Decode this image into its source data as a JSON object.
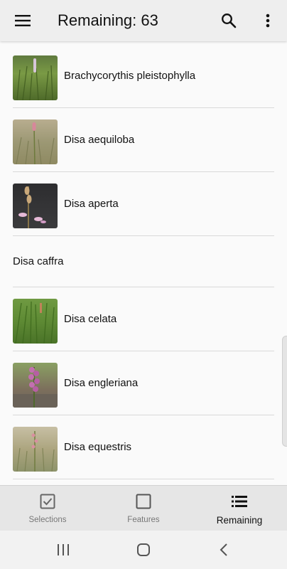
{
  "app_bar": {
    "title": "Remaining: 63",
    "menu_icon": "hamburger-menu-icon",
    "search_icon": "search-icon",
    "more_icon": "more-vert-icon"
  },
  "list": {
    "items": [
      {
        "label": "Brachycorythis pleistophylla",
        "has_image": true
      },
      {
        "label": "Disa aequiloba",
        "has_image": true
      },
      {
        "label": "Disa aperta",
        "has_image": true
      },
      {
        "label": "Disa caffra",
        "has_image": false
      },
      {
        "label": "Disa celata",
        "has_image": true
      },
      {
        "label": "Disa engleriana",
        "has_image": true
      },
      {
        "label": "Disa equestris",
        "has_image": true
      }
    ]
  },
  "bottom_nav": {
    "items": [
      {
        "label": "Selections",
        "icon": "checkbox-checked-icon",
        "active": false
      },
      {
        "label": "Features",
        "icon": "checkbox-empty-icon",
        "active": false
      },
      {
        "label": "Remaining",
        "icon": "list-icon",
        "active": true
      }
    ]
  },
  "system_nav": {
    "recents_icon": "recents-icon",
    "home_icon": "home-icon",
    "back_icon": "back-icon"
  },
  "colors": {
    "app_bar_bg": "#eeeeee",
    "bottom_nav_bg": "#e6e6e6",
    "active_label": "#111111",
    "inactive_label": "#777777"
  }
}
